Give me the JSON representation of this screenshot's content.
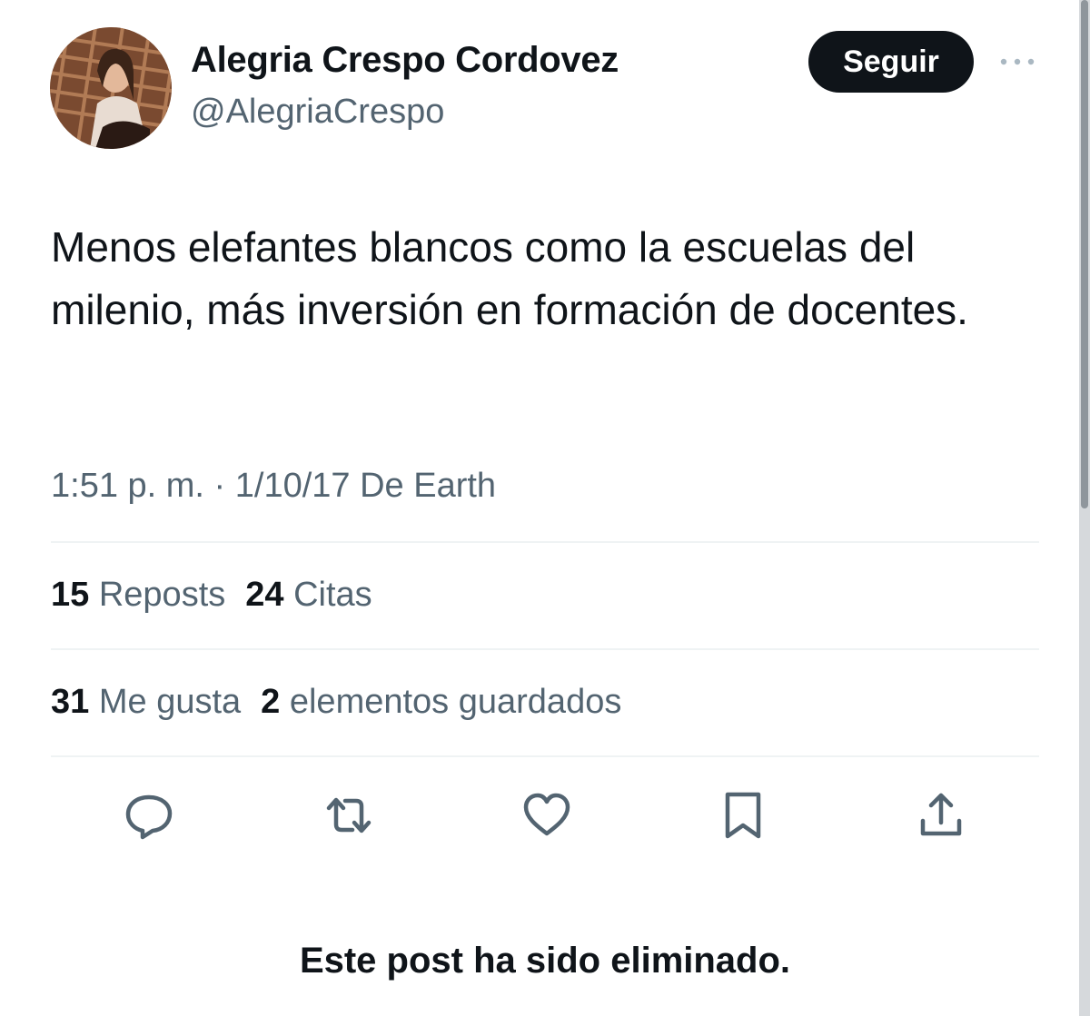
{
  "author": {
    "display_name": "Alegria Crespo Cordovez",
    "handle": "@AlegriaCrespo"
  },
  "header": {
    "follow_label": "Seguir",
    "more_icon": "more-horizontal-icon"
  },
  "tweet": {
    "text": "Menos elefantes blancos como la escuelas del milenio, más inversión en formación de docentes.",
    "timestamp": "1:51 p. m. · 1/10/17 De Earth"
  },
  "stats": {
    "reposts_count": "15",
    "reposts_label": "Reposts",
    "quotes_count": "24",
    "quotes_label": "Citas",
    "likes_count": "31",
    "likes_label": "Me gusta",
    "bookmarks_count": "2",
    "bookmarks_label": "elementos guardados"
  },
  "actions": {
    "icons": [
      "reply-icon",
      "repost-icon",
      "like-icon",
      "bookmark-icon",
      "share-icon"
    ]
  },
  "notice": {
    "deleted_text": "Este post ha sido eliminado."
  },
  "colors": {
    "text_primary": "#0f1419",
    "text_secondary": "#536471",
    "divider": "#eff3f4",
    "button_bg": "#0f1419",
    "button_text": "#ffffff"
  }
}
